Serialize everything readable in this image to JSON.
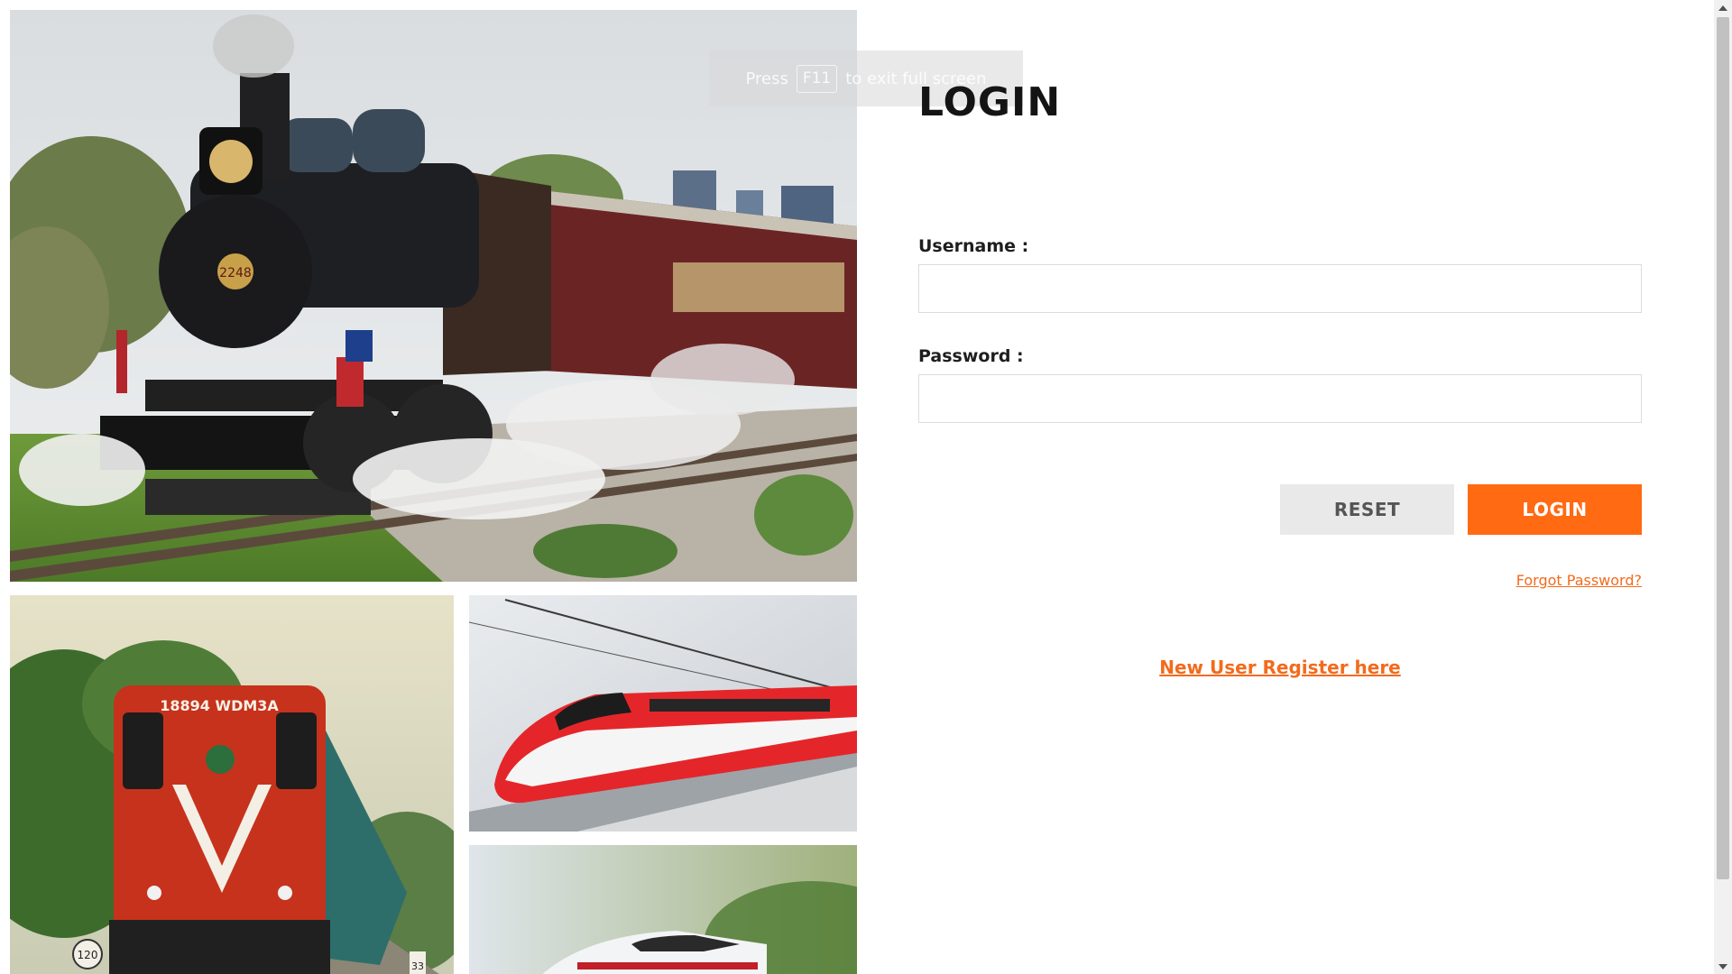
{
  "overlay": {
    "prefix": "Press",
    "key": "F11",
    "suffix": "to exit full screen"
  },
  "images": {
    "steam_number": "2248",
    "diesel_number": "18894 WDM3A",
    "diesel_sign_left": "120",
    "diesel_sign_right": "33"
  },
  "login": {
    "title": "LOGIN",
    "username_label": "Username :",
    "username_value": "",
    "password_label": "Password :",
    "password_value": "",
    "reset_label": "RESET",
    "login_label": "LOGIN",
    "forgot_label": "Forgot Password?",
    "register_label": "New User Register here"
  },
  "colors": {
    "accent": "#ff6a13",
    "reset_bg": "#e9e9e9",
    "link": "#f26b1d"
  }
}
